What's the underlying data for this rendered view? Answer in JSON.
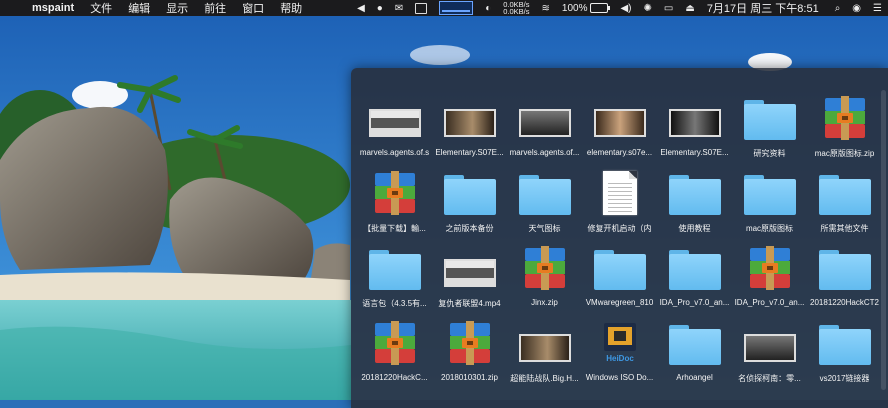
{
  "menubar": {
    "apple_glyph": "",
    "app_name": "mspaint",
    "menus": [
      "文件",
      "编辑",
      "显示",
      "前往",
      "窗口",
      "帮助"
    ],
    "net_up": "0.0KB/s",
    "net_down": "0.0KB/s",
    "battery": "100%",
    "datetime": "7月17日 周三 下午8:51"
  },
  "stack": {
    "items": [
      {
        "label": "marvels.agents.of.s",
        "type": "video"
      },
      {
        "label": "Elementary.S07E...",
        "type": "video"
      },
      {
        "label": "marvels.agents.of...",
        "type": "video"
      },
      {
        "label": "elementary.s07e...",
        "type": "video"
      },
      {
        "label": "Elementary.S07E...",
        "type": "video"
      },
      {
        "label": "研究资料",
        "type": "folder"
      },
      {
        "label": "mac原版图标.zip",
        "type": "archive"
      },
      {
        "label": "【批量下载】輸...",
        "type": "archive"
      },
      {
        "label": "之前版本备份",
        "type": "folder"
      },
      {
        "label": "天气图标",
        "type": "folder"
      },
      {
        "label": "修复开机启动（内",
        "type": "document"
      },
      {
        "label": "使用教程",
        "type": "folder"
      },
      {
        "label": "mac原版图标",
        "type": "folder"
      },
      {
        "label": "所需其他文件",
        "type": "folder"
      },
      {
        "label": "语言包（4.3.5有...",
        "type": "folder"
      },
      {
        "label": "复仇者联盟4.mp4",
        "type": "video"
      },
      {
        "label": "Jinx.zip",
        "type": "archive"
      },
      {
        "label": "VMwaregreen_810",
        "type": "folder"
      },
      {
        "label": "IDA_Pro_v7.0_an...",
        "type": "folder"
      },
      {
        "label": "IDA_Pro_v7.0_an...",
        "type": "archive"
      },
      {
        "label": "20181220HackCT2",
        "type": "folder"
      },
      {
        "label": "20181220HackC...",
        "type": "archive"
      },
      {
        "label": "2018010301.zip",
        "type": "archive"
      },
      {
        "label": "超能陆战队.Big.H...",
        "type": "video"
      },
      {
        "label": "Windows ISO Do...",
        "type": "heidoc"
      },
      {
        "label": "Arhoangel",
        "type": "folder"
      },
      {
        "label": "名侦探柯南：零...",
        "type": "video"
      },
      {
        "label": "vs2017链接器",
        "type": "folder"
      }
    ],
    "heidoc_text": "HeiDoc"
  },
  "colors": {
    "folder": "#7cc8f5",
    "archive_blue": "#2f7fd6",
    "archive_orange": "#e77c21",
    "archive_green": "#4caa3c",
    "archive_red": "#d43e3a"
  }
}
